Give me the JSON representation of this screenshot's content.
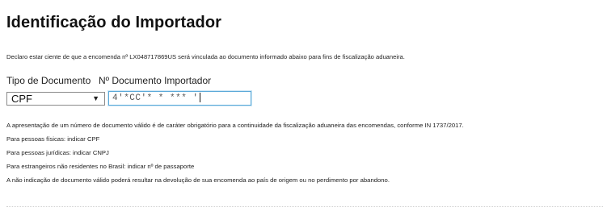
{
  "page": {
    "title": "Identificação do Importador",
    "declaration": "Declaro estar ciente de que a encomenda nº LX048717869US será vinculada ao documento informado abaixo para fins de fiscalização aduaneira."
  },
  "form": {
    "document_type_label": "Tipo de Documento",
    "document_number_label": "Nº Documento Importador",
    "document_type_selected": "CPF",
    "document_number_value": "4'*CC'* *   *** '"
  },
  "info_lines": [
    "A apresentação de um número de documento válido é de caráter obrigatório para a continuidade da fiscalização aduaneira das encomendas, conforme IN 1737/2017.",
    "Para pessoas físicas: indicar CPF",
    "Para pessoas jurídicas: indicar CNPJ",
    "Para estrangeiros não residentes no Brasil: indicar nº de passaporte",
    "A não indicação de documento válido poderá resultar na devolução de sua encomenda ao país de origem ou no perdimento por abandono."
  ],
  "icons": {
    "select_arrow": "chevron-down-icon"
  },
  "colors": {
    "input_focus_border": "#5aa9d8",
    "text": "#111111"
  }
}
